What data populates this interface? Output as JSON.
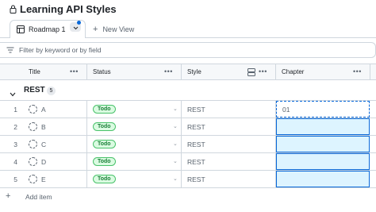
{
  "project": {
    "title": "Learning API Styles"
  },
  "tabs": [
    {
      "label": "Roadmap 1"
    }
  ],
  "new_view_label": "New View",
  "filter": {
    "placeholder": "Filter by keyword or by field"
  },
  "columns": [
    {
      "label": "Title"
    },
    {
      "label": "Status"
    },
    {
      "label": "Style"
    },
    {
      "label": "Chapter"
    }
  ],
  "group": {
    "name": "REST",
    "count": "5"
  },
  "rows": [
    {
      "num": "1",
      "title": "A",
      "status": "Todo",
      "style": "REST",
      "chapter": "01"
    },
    {
      "num": "2",
      "title": "B",
      "status": "Todo",
      "style": "REST",
      "chapter": ""
    },
    {
      "num": "3",
      "title": "C",
      "status": "Todo",
      "style": "REST",
      "chapter": ""
    },
    {
      "num": "4",
      "title": "D",
      "status": "Todo",
      "style": "REST",
      "chapter": ""
    },
    {
      "num": "5",
      "title": "E",
      "status": "Todo",
      "style": "REST",
      "chapter": ""
    }
  ],
  "add_item_label": "Add item",
  "colors": {
    "accent": "#0969da",
    "todo_bg": "#dafbe1",
    "todo_text": "#1a7f37",
    "selection": "#ddf4ff"
  }
}
